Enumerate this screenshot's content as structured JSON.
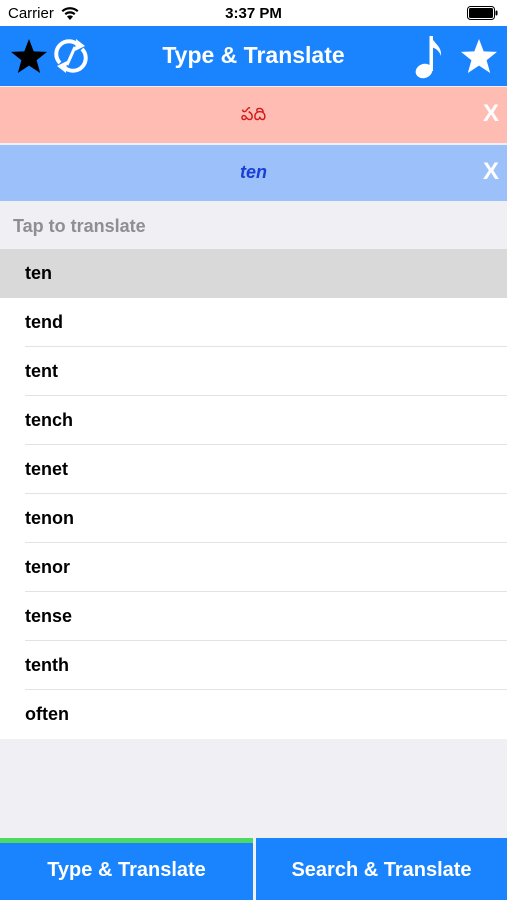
{
  "status": {
    "carrier": "Carrier",
    "time": "3:37 PM"
  },
  "nav": {
    "title": "Type & Translate"
  },
  "source_translation": {
    "text": "పది",
    "clear_label": "X"
  },
  "input": {
    "text": "ten",
    "clear_label": "X"
  },
  "section": {
    "header": "Tap to translate"
  },
  "suggestions": [
    {
      "label": "ten"
    },
    {
      "label": "tend"
    },
    {
      "label": "tent"
    },
    {
      "label": "tench"
    },
    {
      "label": "tenet"
    },
    {
      "label": "tenon"
    },
    {
      "label": "tenor"
    },
    {
      "label": "tense"
    },
    {
      "label": "tenth"
    },
    {
      "label": "often"
    }
  ],
  "tabs": [
    {
      "label": "Type & Translate"
    },
    {
      "label": "Search & Translate"
    }
  ],
  "colors": {
    "accent": "#1a84ff",
    "active_tab_indicator": "#4cd964",
    "source_bg": "#ffbcb2",
    "input_bg": "#9cc1fa"
  }
}
